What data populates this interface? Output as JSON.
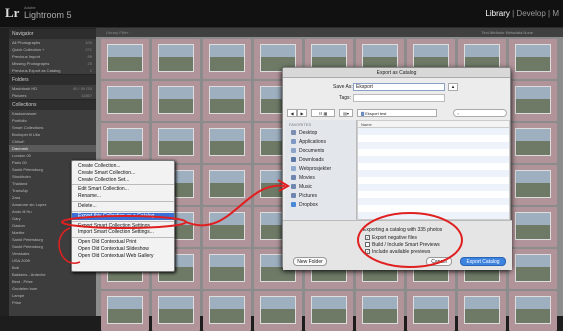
{
  "app": {
    "adobe": "Adobe",
    "name": "Lightroom 5",
    "logo": "Lr"
  },
  "modules": [
    "Library",
    "Develop",
    "M"
  ],
  "sidebar": {
    "navigator": "Navigator",
    "catalog": [
      {
        "label": "All Photographs",
        "count": "100"
      },
      {
        "label": "Quick Collection +",
        "count": "271"
      },
      {
        "label": "Previous Import",
        "count": "89"
      },
      {
        "label": "Missing Photographs",
        "count": "20"
      },
      {
        "label": "Previous Export as Catalog",
        "count": "1"
      }
    ],
    "folders": "Folders",
    "folder_rows": [
      {
        "label": "Macintosh HD",
        "count": "40 / 99 GB"
      },
      {
        "label": "Pictures",
        "count": "11857"
      }
    ],
    "collections": "Collections",
    "collection_rows": [
      "Kaskumanuer",
      "Portfolio",
      "Smart Collections",
      "Brollopet til Ulla",
      "Chiloé!",
      "Danmark",
      "London 00",
      "Paris 00",
      "Sankt Petersburg",
      "Stockholm",
      "Thailand",
      "TransAlp",
      "Zara",
      "Amarone sin Lopez",
      "Ando til Hu",
      "Gary",
      "Gaston",
      "Marthe",
      "Sankt Petersburg",
      "Sankt Petersburg",
      "Venskabs",
      "USA 2009",
      "Bob",
      "Bakkens - Ardeche",
      "Best - Prise",
      "Gurdelen bom",
      "Lampe",
      "Prise"
    ]
  },
  "filter_bar": {
    "label": "Library Filter :",
    "tabs": "Text   Attribute   Metadata   None"
  },
  "context_menu": {
    "items": [
      "Create Collection...",
      "Create Smart Collection...",
      "Create Collection Set...",
      "-",
      "Edit Smart Collection...",
      "Rename...",
      "-",
      "Delete...",
      "-",
      "Export this Collection as a Catalog...",
      "-",
      "Export Smart Collection Settings...",
      "Import Smart Collection Settings...",
      "-",
      "Open Old Contextual Print",
      "Open Old Contextual Slideshow",
      "Open Old Contextual Web Gallery"
    ],
    "highlighted_index": 9
  },
  "dialog": {
    "title": "Export as Catalog",
    "save_as_label": "Save As:",
    "save_as_value": "Eksport",
    "tags_label": "Tags:",
    "location": "Eksport test",
    "search_placeholder": "",
    "favorites_header": "FAVORITES",
    "favorites": [
      {
        "label": "Desktop",
        "icon": "desktop-icon",
        "color": "#7a8fb3"
      },
      {
        "label": "Applications",
        "icon": "applications-icon",
        "color": "#7f9ac4"
      },
      {
        "label": "Documents",
        "icon": "documents-icon",
        "color": "#8da5c9"
      },
      {
        "label": "Downloads",
        "icon": "downloads-icon",
        "color": "#5c79a8"
      },
      {
        "label": "Webprosjekter",
        "icon": "folder-icon",
        "color": "#8fa9cf"
      },
      {
        "label": "Movies",
        "icon": "movies-icon",
        "color": "#6f87b0"
      },
      {
        "label": "Music",
        "icon": "music-icon",
        "color": "#6f87b0"
      },
      {
        "label": "Pictures",
        "icon": "pictures-icon",
        "color": "#6f87b0"
      },
      {
        "label": "Dropbox",
        "icon": "dropbox-icon",
        "color": "#4a89d8"
      }
    ],
    "column_header": "Name",
    "status": "Exporting a catalog with 335 photos",
    "options": [
      {
        "label": "Export negative files",
        "checked": true
      },
      {
        "label": "Build / Include Smart Previews",
        "checked": false
      },
      {
        "label": "Include available previews",
        "checked": true
      }
    ],
    "new_folder": "New Folder",
    "cancel": "Cancel",
    "export": "Export Catalog"
  },
  "colors": {
    "annotation": "#e02020",
    "accent": "#3d83e0"
  }
}
